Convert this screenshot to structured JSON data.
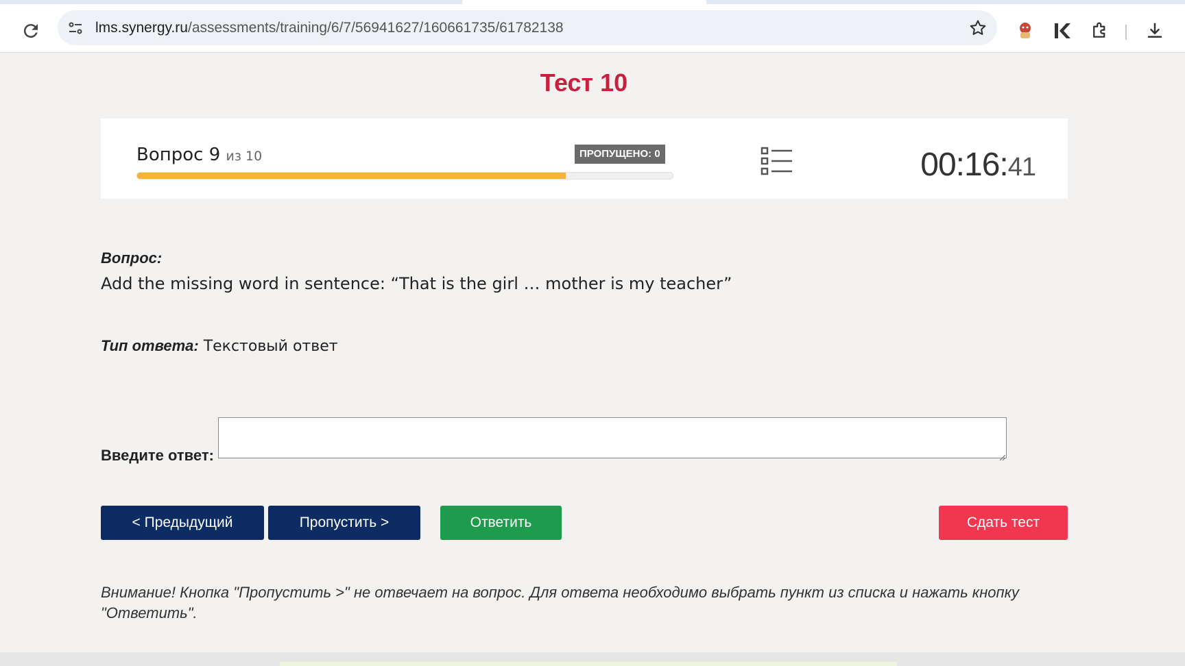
{
  "browser": {
    "url_host": "lms.synergy.ru",
    "url_path": "/assessments/training/6/7/56941627/160661735/61782138",
    "icons": [
      "reload-icon",
      "site-info-icon",
      "bookmark-star-icon",
      "extension-avatar-icon",
      "kaspersky-icon",
      "extensions-puzzle-icon",
      "download-icon"
    ]
  },
  "page": {
    "title": "Тест 10",
    "accent_color": "#c8203e"
  },
  "status": {
    "question_label": "Вопрос 9",
    "question_of": "из 10",
    "current": 9,
    "total": 10,
    "progress_fraction": 0.8,
    "skipped_badge": "ПРОПУЩЕНО: 0",
    "timer_main": "00:16:",
    "timer_seconds": "41"
  },
  "question": {
    "label": "Вопрос:",
    "text": "Add the missing word in sentence: “That is the girl … mother is my teacher”",
    "answer_type_label": "Тип ответа:",
    "answer_type_value": "Текстовый ответ"
  },
  "answer": {
    "label": "Введите ответ:",
    "value": ""
  },
  "buttons": {
    "prev": "< Предыдущий",
    "skip": "Пропустить >",
    "answer": "Ответить",
    "submit": "Сдать тест",
    "colors": {
      "nav": "#0c2c63",
      "answer": "#1f9b4d",
      "submit": "#f0374f"
    }
  },
  "note": "Внимание! Кнопка \"Пропустить >\" не отвечает на вопрос. Для ответа необходимо выбрать пункт из списка и нажать кнопку \"Ответить\"."
}
